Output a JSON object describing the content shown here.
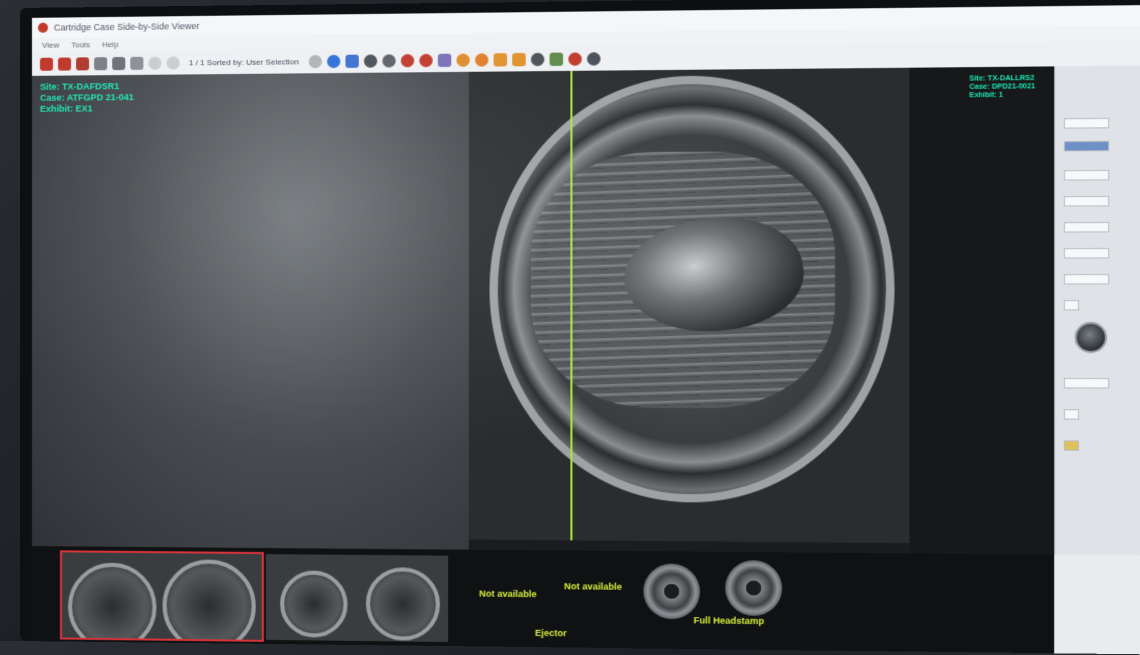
{
  "window": {
    "title": "Cartridge Case Side-by-Side Viewer",
    "menu": [
      "View",
      "Tools",
      "Help"
    ]
  },
  "toolbar": {
    "sort_text": "1 / 1 Sorted by: User Selection",
    "icons": [
      "home-icon",
      "gear-icon",
      "refresh-icon",
      "save-icon",
      "print-icon",
      "record-icon",
      "prev-icon",
      "next-icon",
      "skip-back-icon",
      "skip-forward-icon",
      "move-icon",
      "rotate-icon",
      "target-icon",
      "zoom-in-icon",
      "zoom-out-icon",
      "image-adjust-icon",
      "light-icon",
      "light-alt-icon",
      "arrow-left-icon",
      "arrow-right-icon",
      "crosshair-icon",
      "measure-icon",
      "star-icon",
      "info-icon"
    ]
  },
  "left_image": {
    "site": "Site: TX-DAFDSR1",
    "case": "Case: ATFGPD 21-041",
    "exhibit": "Exhibit: EX1"
  },
  "right_image": {
    "site": "Site: TX-DALLRS2",
    "case": "Case: DPD21-0021",
    "exhibit": "Exhibit: 1"
  },
  "bottom_strip": {
    "labels": [
      "Not available",
      "Not available",
      "Ejector",
      "Full Headstamp"
    ]
  },
  "colors": {
    "overlay_text": "#1ee6b5",
    "comparison_line": "#a8e53a",
    "strip_label": "#d9ef3a",
    "selection": "#d8333b"
  }
}
